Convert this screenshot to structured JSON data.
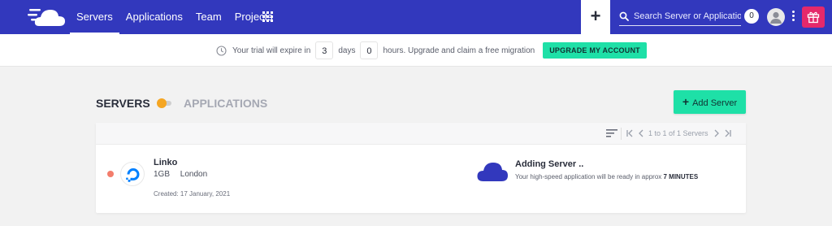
{
  "colors": {
    "nav_bg": "#3238bd",
    "accent": "#1ee0a7",
    "gift": "#e5296b",
    "status_dot": "#f37d6c",
    "toggle_knob": "#f5a623",
    "cloud": "#3238bd"
  },
  "nav": {
    "items": [
      {
        "label": "Servers",
        "active": true
      },
      {
        "label": "Applications",
        "active": false
      },
      {
        "label": "Team",
        "active": false
      },
      {
        "label": "Projects",
        "active": false
      }
    ],
    "plus_label": "+",
    "search_placeholder": "Search Server or Application",
    "notifications": "0"
  },
  "trial": {
    "prefix": "Your trial will expire in",
    "days_value": "3",
    "days_label": "days",
    "hours_value": "0",
    "hours_suffix": "hours. Upgrade and claim a free migration",
    "button": "UPGRADE MY ACCOUNT"
  },
  "header": {
    "servers_title": "SERVERS",
    "apps_title": "APPLICATIONS",
    "add_button": "Add Server"
  },
  "pagination": {
    "text": "1 to 1 of 1 Servers"
  },
  "server": {
    "name": "Linko",
    "size": "1GB",
    "location": "London",
    "created": "Created: 17 January, 2021",
    "status_title": "Adding Server ..",
    "status_desc": "Your high-speed application will be ready in approx",
    "status_eta": "7 MINUTES"
  },
  "icons": {
    "logo": "cloudways-logo",
    "grid": "apps-grid-icon",
    "search": "search-icon",
    "avatar": "user-avatar-icon",
    "menu": "kebab-menu-icon",
    "gift": "gift-icon",
    "clock": "clock-icon",
    "sort": "sort-icon",
    "first": "first-page-icon",
    "prev": "prev-page-icon",
    "next": "next-page-icon",
    "last": "last-page-icon",
    "provider": "digitalocean-icon",
    "cloud": "cloud-icon"
  }
}
